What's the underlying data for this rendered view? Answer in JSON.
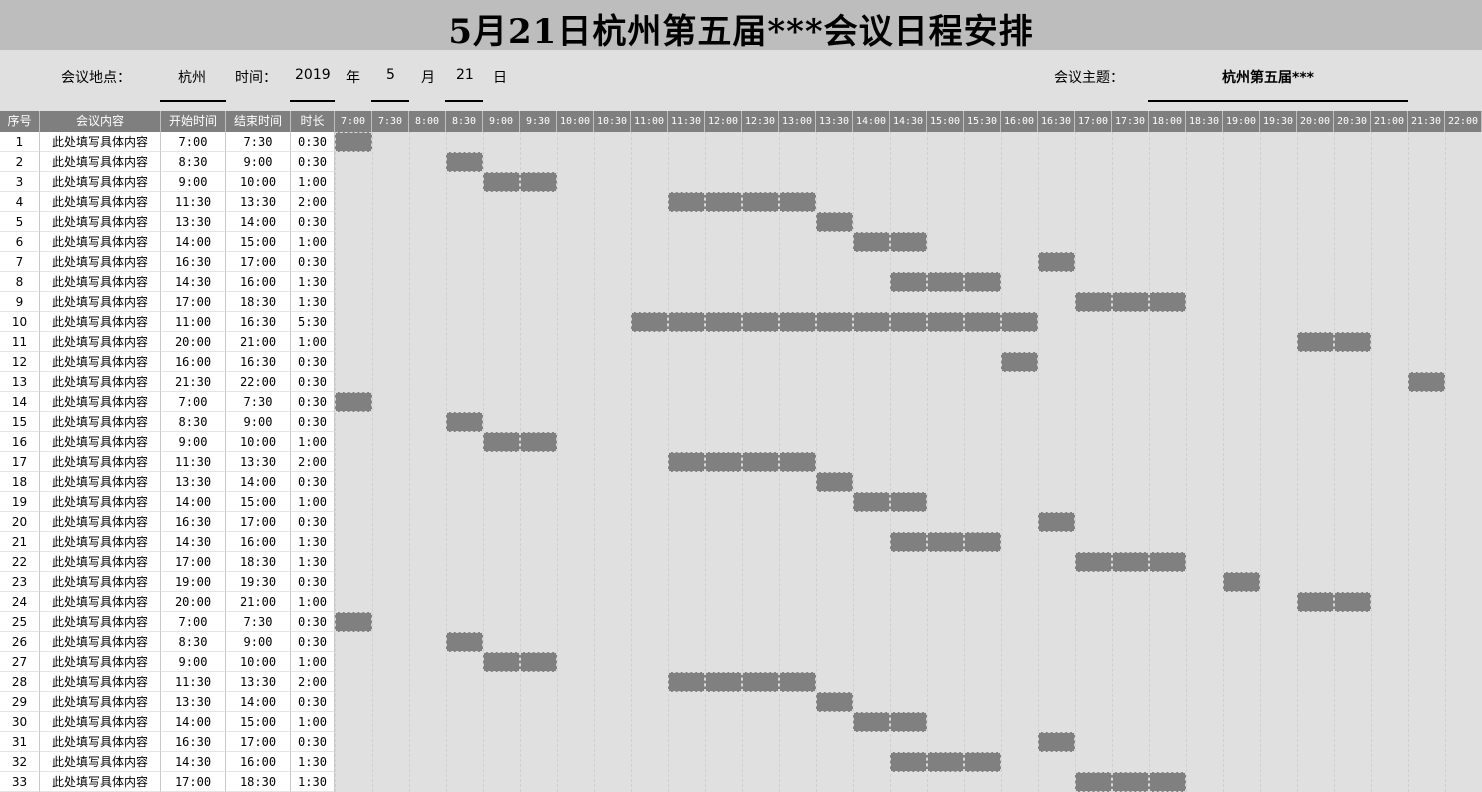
{
  "title": "5月21日杭州第五届***会议日程安排",
  "info": {
    "location_label": "会议地点：",
    "location": "杭州",
    "time_label": "时间：",
    "year": "2019",
    "year_unit": "年",
    "month": "5",
    "month_unit": "月",
    "day": "21",
    "day_unit": "日",
    "topic_label": "会议主题：",
    "topic": "杭州第五届***"
  },
  "headers": {
    "seq": "序号",
    "content": "会议内容",
    "start": "开始时间",
    "end": "结束时间",
    "duration": "时长"
  },
  "time_slots": [
    "7:00",
    "7:30",
    "8:00",
    "8:30",
    "9:00",
    "9:30",
    "10:00",
    "10:30",
    "11:00",
    "11:30",
    "12:00",
    "12:30",
    "13:00",
    "13:30",
    "14:00",
    "14:30",
    "15:00",
    "15:30",
    "16:00",
    "16:30",
    "17:00",
    "17:30",
    "18:00",
    "18:30",
    "19:00",
    "19:30",
    "20:00",
    "20:30",
    "21:00",
    "21:30",
    "22:00"
  ],
  "rows": [
    {
      "seq": "1",
      "content": "此处填写具体内容",
      "start": "7:00",
      "end": "7:30",
      "duration": "0:30"
    },
    {
      "seq": "2",
      "content": "此处填写具体内容",
      "start": "8:30",
      "end": "9:00",
      "duration": "0:30"
    },
    {
      "seq": "3",
      "content": "此处填写具体内容",
      "start": "9:00",
      "end": "10:00",
      "duration": "1:00"
    },
    {
      "seq": "4",
      "content": "此处填写具体内容",
      "start": "11:30",
      "end": "13:30",
      "duration": "2:00"
    },
    {
      "seq": "5",
      "content": "此处填写具体内容",
      "start": "13:30",
      "end": "14:00",
      "duration": "0:30"
    },
    {
      "seq": "6",
      "content": "此处填写具体内容",
      "start": "14:00",
      "end": "15:00",
      "duration": "1:00"
    },
    {
      "seq": "7",
      "content": "此处填写具体内容",
      "start": "16:30",
      "end": "17:00",
      "duration": "0:30"
    },
    {
      "seq": "8",
      "content": "此处填写具体内容",
      "start": "14:30",
      "end": "16:00",
      "duration": "1:30"
    },
    {
      "seq": "9",
      "content": "此处填写具体内容",
      "start": "17:00",
      "end": "18:30",
      "duration": "1:30"
    },
    {
      "seq": "10",
      "content": "此处填写具体内容",
      "start": "11:00",
      "end": "16:30",
      "duration": "5:30"
    },
    {
      "seq": "11",
      "content": "此处填写具体内容",
      "start": "20:00",
      "end": "21:00",
      "duration": "1:00"
    },
    {
      "seq": "12",
      "content": "此处填写具体内容",
      "start": "16:00",
      "end": "16:30",
      "duration": "0:30"
    },
    {
      "seq": "13",
      "content": "此处填写具体内容",
      "start": "21:30",
      "end": "22:00",
      "duration": "0:30"
    },
    {
      "seq": "14",
      "content": "此处填写具体内容",
      "start": "7:00",
      "end": "7:30",
      "duration": "0:30"
    },
    {
      "seq": "15",
      "content": "此处填写具体内容",
      "start": "8:30",
      "end": "9:00",
      "duration": "0:30"
    },
    {
      "seq": "16",
      "content": "此处填写具体内容",
      "start": "9:00",
      "end": "10:00",
      "duration": "1:00"
    },
    {
      "seq": "17",
      "content": "此处填写具体内容",
      "start": "11:30",
      "end": "13:30",
      "duration": "2:00"
    },
    {
      "seq": "18",
      "content": "此处填写具体内容",
      "start": "13:30",
      "end": "14:00",
      "duration": "0:30"
    },
    {
      "seq": "19",
      "content": "此处填写具体内容",
      "start": "14:00",
      "end": "15:00",
      "duration": "1:00"
    },
    {
      "seq": "20",
      "content": "此处填写具体内容",
      "start": "16:30",
      "end": "17:00",
      "duration": "0:30"
    },
    {
      "seq": "21",
      "content": "此处填写具体内容",
      "start": "14:30",
      "end": "16:00",
      "duration": "1:30"
    },
    {
      "seq": "22",
      "content": "此处填写具体内容",
      "start": "17:00",
      "end": "18:30",
      "duration": "1:30"
    },
    {
      "seq": "23",
      "content": "此处填写具体内容",
      "start": "19:00",
      "end": "19:30",
      "duration": "0:30"
    },
    {
      "seq": "24",
      "content": "此处填写具体内容",
      "start": "20:00",
      "end": "21:00",
      "duration": "1:00"
    },
    {
      "seq": "25",
      "content": "此处填写具体内容",
      "start": "7:00",
      "end": "7:30",
      "duration": "0:30"
    },
    {
      "seq": "26",
      "content": "此处填写具体内容",
      "start": "8:30",
      "end": "9:00",
      "duration": "0:30"
    },
    {
      "seq": "27",
      "content": "此处填写具体内容",
      "start": "9:00",
      "end": "10:00",
      "duration": "1:00"
    },
    {
      "seq": "28",
      "content": "此处填写具体内容",
      "start": "11:30",
      "end": "13:30",
      "duration": "2:00"
    },
    {
      "seq": "29",
      "content": "此处填写具体内容",
      "start": "13:30",
      "end": "14:00",
      "duration": "0:30"
    },
    {
      "seq": "30",
      "content": "此处填写具体内容",
      "start": "14:00",
      "end": "15:00",
      "duration": "1:00"
    },
    {
      "seq": "31",
      "content": "此处填写具体内容",
      "start": "16:30",
      "end": "17:00",
      "duration": "0:30"
    },
    {
      "seq": "32",
      "content": "此处填写具体内容",
      "start": "14:30",
      "end": "16:00",
      "duration": "1:30"
    },
    {
      "seq": "33",
      "content": "此处填写具体内容",
      "start": "17:00",
      "end": "18:30",
      "duration": "1:30"
    }
  ],
  "colors": {
    "header_bg": "#7f7f7f",
    "bar": "#808080",
    "title_bg": "#bdbdbd",
    "sheet_bg": "#e0e0e0"
  }
}
